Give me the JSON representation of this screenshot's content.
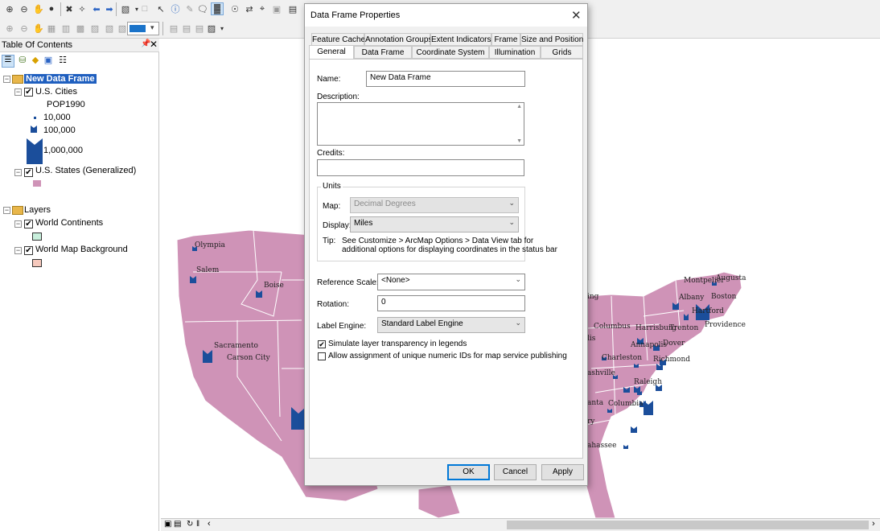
{
  "toc": {
    "title": "Table Of Contents",
    "pin": "↕",
    "close": "✕",
    "data_frame": "New Data Frame",
    "cities_layer": "U.S. Cities",
    "cities_field": "POP1990",
    "legend_small": "10,000",
    "legend_medium": "100,000",
    "legend_large": "1,000,000",
    "states_layer": "U.S. States (Generalized)",
    "layers_frame": "Layers",
    "continents_layer": "World Continents",
    "background_layer": "World Map Background"
  },
  "colors": {
    "state_fill": "#cf93b7",
    "state_border": "#ffffff",
    "city_symbol": "#1b4e9b",
    "continent_swatch": "#c8efdc",
    "background_swatch": "#f6c9bd",
    "accent": "#0078d7"
  },
  "map_labels": {
    "olympia": "Olympia",
    "salem": "Salem",
    "boise": "Boise",
    "sacramento": "Sacramento",
    "carson_city": "Carson City",
    "montpelier": "Montpelier",
    "augusta": "Augusta",
    "albany": "Albany",
    "boston": "Boston",
    "hartford": "Hartford",
    "providence": "Providence",
    "columbus": "Columbus",
    "harrisburg": "Harrisburg",
    "trenton": "Trenton",
    "annapolis": "Annapolis",
    "dover": "Dover",
    "charleston": "Charleston",
    "richmond": "Richmond",
    "raleigh": "Raleigh",
    "columbia": "Columbia",
    "frag_ing": "ing",
    "frag_lis": "lis",
    "frag_ashville": "ashville",
    "frag_anta": "anta",
    "frag_tallahassee": "ahassee",
    "frag_ry": "ry"
  },
  "dialog": {
    "title": "Data Frame Properties",
    "close": "✕",
    "tabs_row1": [
      "Feature Cache",
      "Annotation Groups",
      "Extent Indicators",
      "Frame",
      "Size and Position"
    ],
    "tabs_row2": [
      "General",
      "Data Frame",
      "Coordinate System",
      "Illumination",
      "Grids"
    ],
    "name_label": "Name:",
    "name_value": "New Data Frame",
    "description_label": "Description:",
    "credits_label": "Credits:",
    "units_group": "Units",
    "map_label": "Map:",
    "map_value": "Decimal Degrees",
    "display_label": "Display:",
    "display_value": "Miles",
    "tip_label": "Tip:",
    "tip_line1": "See Customize > ArcMap Options > Data View tab for",
    "tip_line2": "additional options for displaying coordinates in the status bar",
    "reference_scale_label": "Reference Scale:",
    "reference_scale_value": "<None>",
    "rotation_label": "Rotation:",
    "rotation_value": "0",
    "label_engine_label": "Label Engine:",
    "label_engine_value": "Standard Label Engine",
    "simulate_transparency": "Simulate layer transparency in legends",
    "unique_ids": "Allow assignment of unique numeric IDs for map service publishing",
    "ok": "OK",
    "cancel": "Cancel",
    "apply": "Apply"
  }
}
